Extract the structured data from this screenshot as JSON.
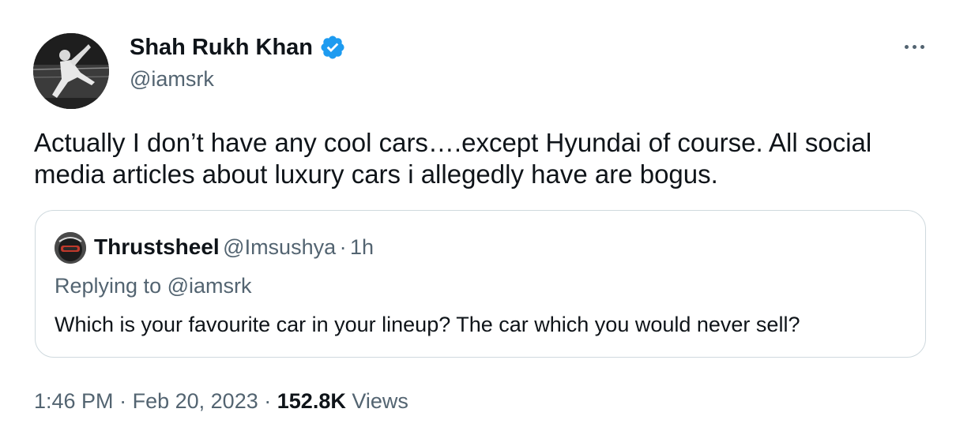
{
  "author": {
    "display_name": "Shah Rukh Khan",
    "handle": "@iamsrk",
    "verified": true,
    "verified_icon": "verified-badge-icon",
    "avatar_icon": "profile-photo"
  },
  "more_menu": {
    "icon": "more-horizontal-icon"
  },
  "tweet": {
    "text": "Actually I don’t have any cool cars….except Hyundai of course. All social media articles about luxury cars i allegedly have are bogus."
  },
  "quoted_tweet": {
    "display_name": "Thrustsheel",
    "handle": "@Imsushya",
    "separator": "·",
    "time": "1h",
    "replying_to": "Replying to @iamsrk",
    "text": "Which is your favourite car in your lineup? The car which you would never sell?"
  },
  "meta": {
    "time": "1:46 PM",
    "separator1": "·",
    "date": "Feb 20, 2023",
    "separator2": "·",
    "views_count": "152.8K",
    "views_label": "Views"
  },
  "colors": {
    "text_primary": "#0f1419",
    "text_secondary": "#536471",
    "border": "#cfd9de",
    "verified_blue": "#1d9bf0",
    "background": "#ffffff"
  }
}
